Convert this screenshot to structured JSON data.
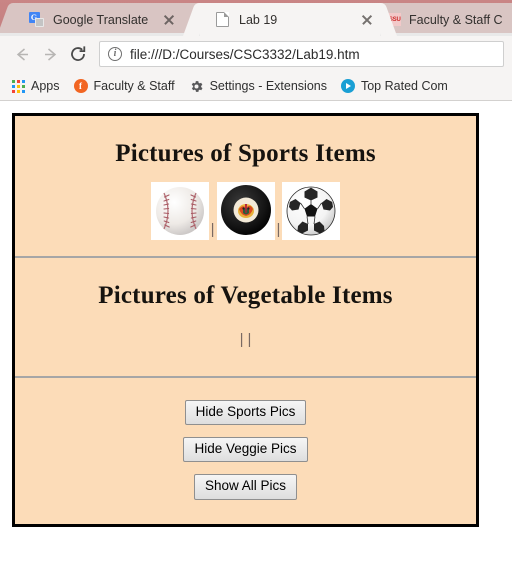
{
  "browser": {
    "tabs": [
      {
        "title": "Google Translate",
        "favicon": "google-translate-icon",
        "active": false,
        "close_label": "×"
      },
      {
        "title": "Lab 19",
        "favicon": "document-icon",
        "active": true,
        "close_label": "×"
      },
      {
        "title": "Faculty & Staff C",
        "favicon": "wssu-icon",
        "active": false,
        "close_label": "×"
      }
    ],
    "toolbar": {
      "back_icon": "back-arrow-icon",
      "forward_icon": "forward-arrow-icon",
      "reload_icon": "reload-icon",
      "site_info_icon": "info-icon",
      "url": "file:///D:/Courses/CSC3332/Lab19.htm",
      "url_scheme": "file:///",
      "url_path": "D:/Courses/CSC3332/Lab19.htm"
    },
    "bookmarks": [
      {
        "label": "Apps",
        "icon": "apps-grid-icon"
      },
      {
        "label": "Faculty & Staff",
        "icon": "faculty-staff-icon"
      },
      {
        "label": "Settings - Extensions",
        "icon": "gear-icon"
      },
      {
        "label": "Top Rated Com",
        "icon": "play-circle-icon"
      }
    ],
    "colors": {
      "tabstrip": "#c47f7f",
      "active_tab": "#f6f4f3",
      "inactive_tab": "#d9c5c3",
      "toolbar": "#f6f4f3"
    }
  },
  "page": {
    "background": "#fcdcb8",
    "border_color": "#000000",
    "divider_color": "#a6a6a6",
    "sections": [
      {
        "id": "sports",
        "heading": "Pictures of Sports Items",
        "images_visible": true,
        "images": [
          {
            "name": "baseball-image",
            "alt": "baseball"
          },
          {
            "name": "hockey-puck-image",
            "alt": "hockey puck"
          },
          {
            "name": "soccer-ball-image",
            "alt": "soccer ball"
          }
        ],
        "separator": "|",
        "separator_count": 2
      },
      {
        "id": "vegetables",
        "heading": "Pictures of Vegetable Items",
        "images_visible": false,
        "images": [],
        "separator": "|",
        "separator_count": 2
      }
    ],
    "buttons": [
      {
        "name": "hide-sports-pics-button",
        "label": "Hide Sports Pics"
      },
      {
        "name": "hide-veggie-pics-button",
        "label": "Hide Veggie Pics"
      },
      {
        "name": "show-all-pics-button",
        "label": "Show All Pics"
      }
    ]
  }
}
